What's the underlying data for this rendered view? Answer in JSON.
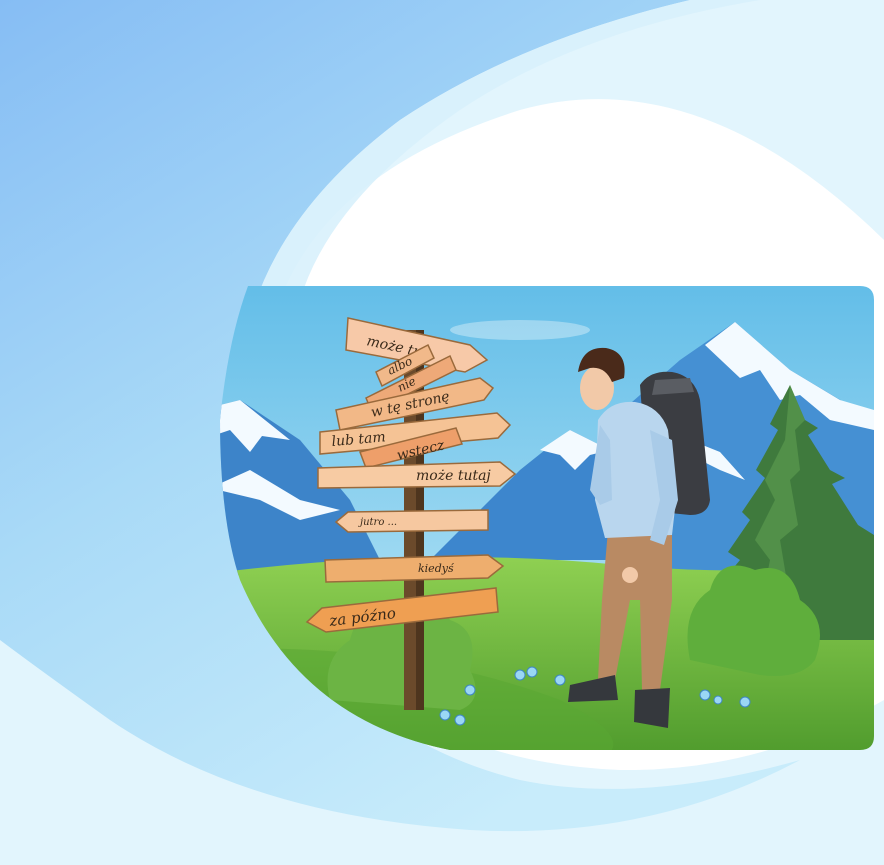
{
  "colors": {
    "blob_light": "#cfeefb",
    "blob_mid": "#9fd3f6",
    "blob_deep": "#7fb6f2",
    "sky_top": "#6cc2ea",
    "sky_bottom": "#b9e6f7",
    "mountain": "#3c86cc",
    "snow": "#f4fbff",
    "grass": "#7cc445",
    "grass_dark": "#4f9a2c",
    "wood": "#f0b97b",
    "wood_dark": "#c98a4a",
    "pole": "#6b4a2b",
    "shirt": "#b9d6ee",
    "pants": "#b98a63",
    "backpack": "#3b3d42",
    "tree": "#3f7a3d"
  },
  "signs": {
    "s1": "może tu",
    "s2": "albo",
    "s3": "nie",
    "s4": "w tę stronę",
    "s5": "lub tam",
    "s6": "wstecz",
    "s7": "może tutaj",
    "s8": "jutro ...",
    "s9": "kiedyś",
    "s10": "za późno"
  }
}
